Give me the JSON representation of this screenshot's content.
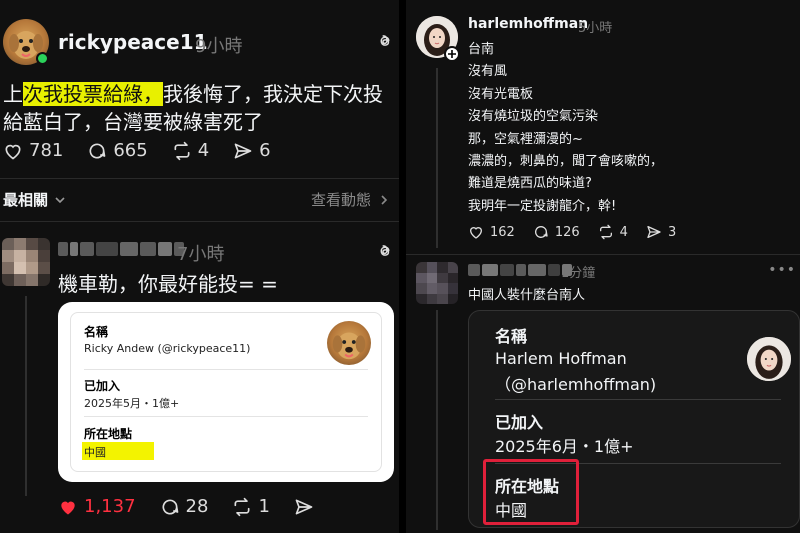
{
  "left": {
    "post": {
      "username": "rickypeace11",
      "time": "9小時",
      "text_prefix": "上",
      "text_highlight": "次我投票給綠，",
      "text_rest": "我後悔了，我決定下次投",
      "text_line2": "給藍白了，台灣要被綠害死了",
      "likes": "781",
      "comments": "665",
      "reposts": "4",
      "shares": "6"
    },
    "sort_label": "最相關",
    "activity_link": "查看動態",
    "reply": {
      "time": "7小時",
      "text": "機車勒，你最好能投= =",
      "card": {
        "name_label": "名稱",
        "name_value": "Ricky Andew (@rickypeace11)",
        "joined_label": "已加入",
        "joined_value": "2025年5月・1億+",
        "location_label": "所在地點",
        "location_value": "中國"
      },
      "likes": "1,137",
      "comments": "28",
      "reposts": "1"
    }
  },
  "right": {
    "post": {
      "username": "harlemhoffman",
      "time": "5小時",
      "lines": [
        "台南",
        "沒有風",
        "沒有光電板",
        "沒有燒垃圾的空氣污染",
        "那，空氣裡瀰漫的~",
        "濃濃的，刺鼻的，聞了會咳嗽的，",
        "難道是燒西瓜的味道?",
        "我明年一定投謝龍介，幹!"
      ],
      "likes": "162",
      "comments": "126",
      "reposts": "4",
      "shares": "3"
    },
    "reply": {
      "time": "1分鐘",
      "text": "中國人裝什麼台南人",
      "card": {
        "name_label": "名稱",
        "name_line1": "Harlem Hoffman",
        "name_line2": "（@harlemhoffman)",
        "joined_label": "已加入",
        "joined_value": "2025年6月・1億+",
        "location_label": "所在地點",
        "location_value": "中國"
      }
    }
  },
  "colors": {
    "highlight": "#e8f000",
    "like_red": "#ff3040",
    "annotation_red": "#e0203a",
    "background": "#101010"
  },
  "icons": [
    "threads-icon",
    "heart-icon",
    "comment-icon",
    "repost-icon",
    "share-icon",
    "chevron-down-icon",
    "chevron-right-icon",
    "more-icon",
    "plus-icon",
    "online-dot-icon"
  ]
}
